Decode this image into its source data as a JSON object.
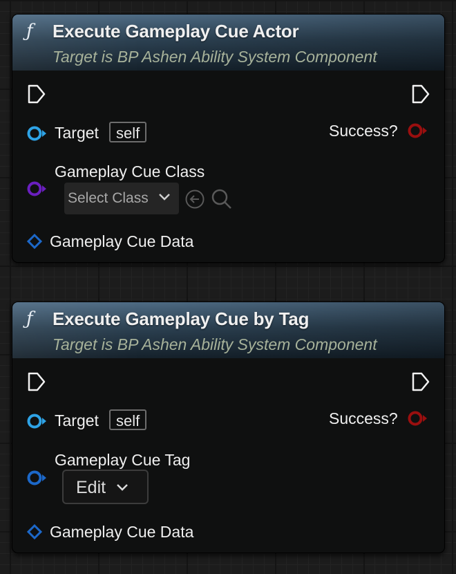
{
  "nodes": [
    {
      "title": "Execute Gameplay Cue Actor",
      "subtitle": "Target is BP Ashen Ability System Component",
      "function_icon": "ƒ",
      "target_label": "Target",
      "target_default": "self",
      "success_label": "Success?",
      "param2_label": "Gameplay Cue Class",
      "param2_value": "Select Class",
      "data_label": "Gameplay Cue Data"
    },
    {
      "title": "Execute Gameplay Cue by Tag",
      "subtitle": "Target is BP Ashen Ability System Component",
      "function_icon": "ƒ",
      "target_label": "Target",
      "target_default": "self",
      "success_label": "Success?",
      "param2_label": "Gameplay Cue Tag",
      "param2_value": "Edit",
      "data_label": "Gameplay Cue Data"
    }
  ],
  "colors": {
    "object_pin": "#2ea3e6",
    "class_pin": "#6a1fbf",
    "struct_pin": "#1c68c9",
    "bool_pin": "#9a0f0f",
    "exec_pin": "#ffffff",
    "header_blue": "#3b5670"
  },
  "icons": {
    "exec": "exec-triangle-icon",
    "use_selected": "arrow-left-circle-icon",
    "browse": "search-icon",
    "dropdown": "chevron-down-icon"
  }
}
